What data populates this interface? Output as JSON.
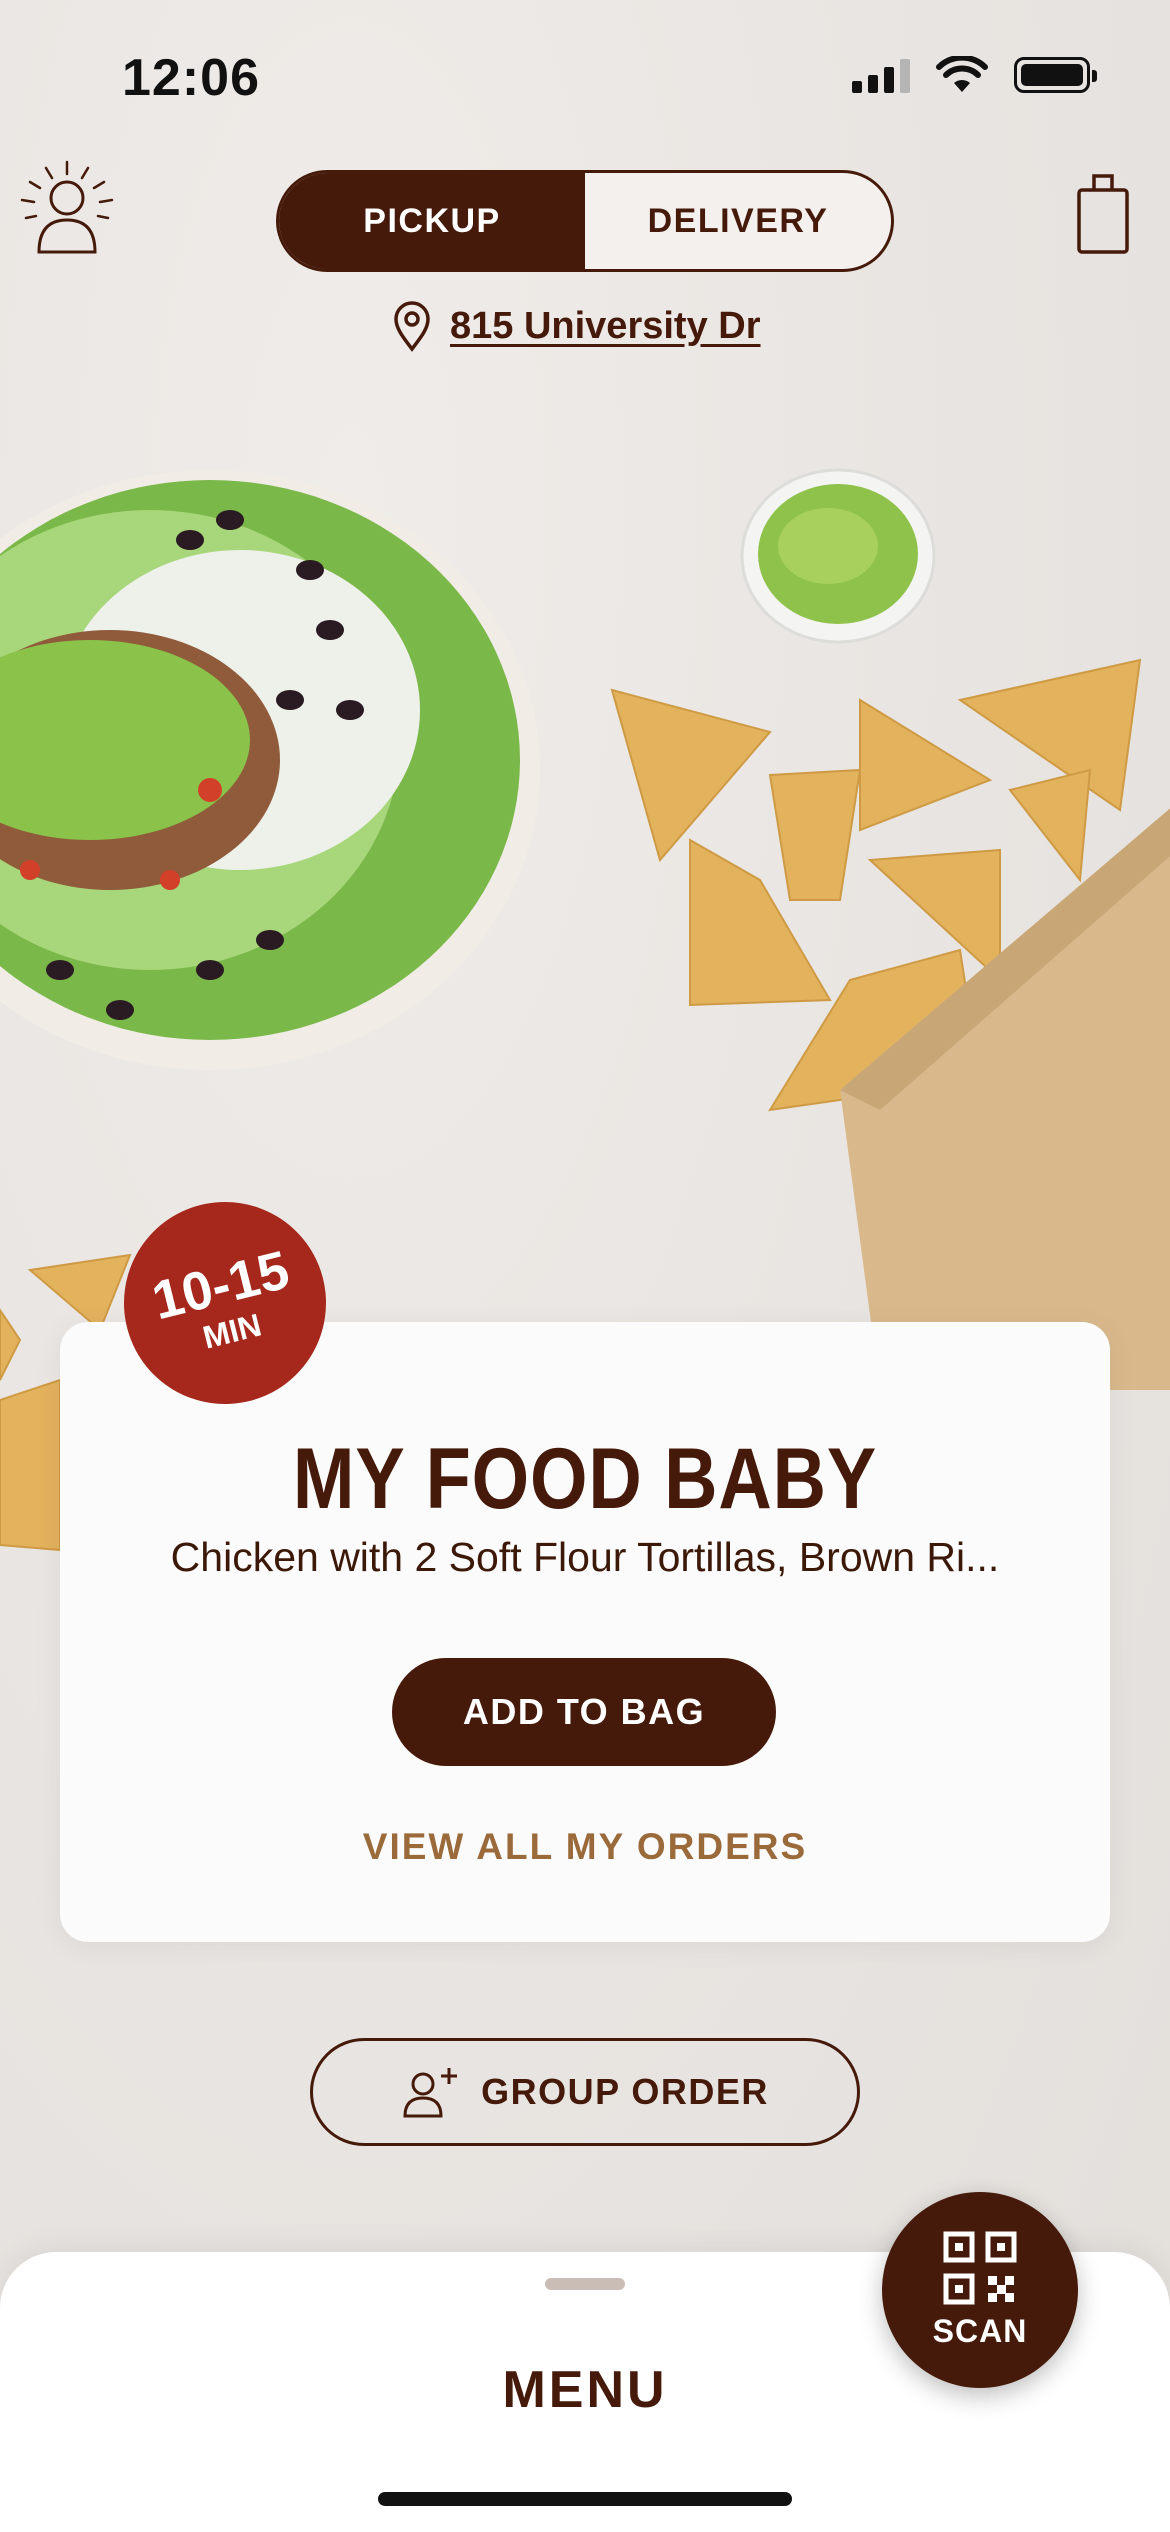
{
  "status_bar": {
    "time": "12:06"
  },
  "header": {
    "order_mode": {
      "active": "PICKUP",
      "inactive": "DELIVERY"
    },
    "location": "815 University Dr"
  },
  "order_card": {
    "badge_time": "10-15",
    "badge_unit": "MIN",
    "title": "MY FOOD BABY",
    "description": "Chicken with 2 Soft Flour Tortillas, Brown Ri...",
    "add_button": "ADD TO BAG",
    "view_all": "VIEW ALL MY ORDERS"
  },
  "group_order": {
    "label": "GROUP ORDER"
  },
  "bottom_sheet": {
    "title": "MENU"
  },
  "scan": {
    "label": "SCAN"
  },
  "colors": {
    "brand_brown": "#451a0a",
    "badge_red": "#a6271b",
    "link_tan": "#9b6a3b"
  },
  "icons": [
    "profile-sun-icon",
    "bag-icon",
    "location-pin-icon",
    "add-person-icon",
    "qr-code-icon"
  ]
}
